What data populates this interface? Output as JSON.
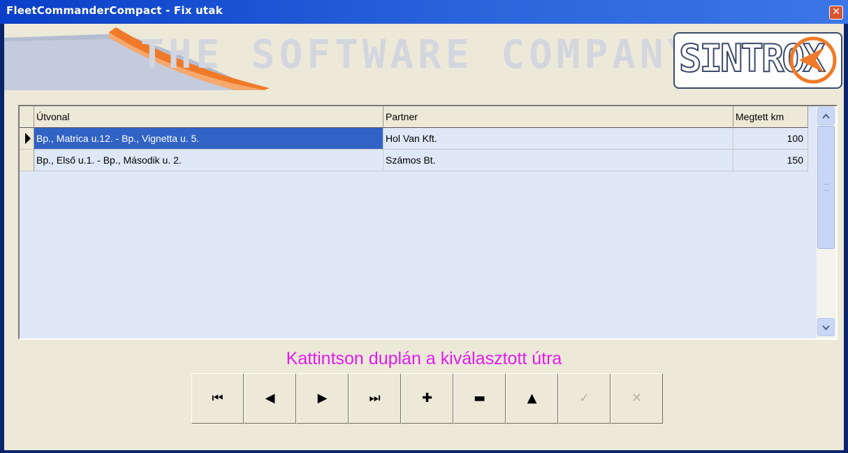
{
  "window": {
    "title": "FleetCommanderCompact - Fix utak",
    "close_glyph": "✕"
  },
  "banner": {
    "tagline": "THE SOFTWARE COMPANY...",
    "logo_text": "SINTROX"
  },
  "grid": {
    "columns": [
      "Útvonal",
      "Partner",
      "Megtett km"
    ],
    "rows": [
      {
        "route": "Bp., Matrica u.12. - Bp., Vignetta u. 5.",
        "partner": "Hol Van Kft.",
        "km": "100",
        "selected": true
      },
      {
        "route": "Bp., Első u.1. - Bp., Második u. 2.",
        "partner": "Számos Bt.",
        "km": "150",
        "selected": false
      }
    ]
  },
  "hint": "Kattintson duplán a kiválasztott útra",
  "navigator": {
    "buttons": [
      {
        "name": "first-record-button",
        "icon": "first-icon",
        "glyph": "⏮",
        "enabled": true
      },
      {
        "name": "prior-record-button",
        "icon": "prior-icon",
        "glyph": "◀",
        "enabled": true
      },
      {
        "name": "next-record-button",
        "icon": "next-icon",
        "glyph": "▶",
        "enabled": true
      },
      {
        "name": "last-record-button",
        "icon": "last-icon",
        "glyph": "⏭",
        "enabled": true
      },
      {
        "name": "insert-record-button",
        "icon": "plus-icon",
        "glyph": "✚",
        "enabled": true
      },
      {
        "name": "delete-record-button",
        "icon": "minus-icon",
        "glyph": "▬",
        "enabled": true
      },
      {
        "name": "edit-record-button",
        "icon": "up-arrow-icon",
        "glyph": "▲",
        "enabled": true
      },
      {
        "name": "post-record-button",
        "icon": "check-icon",
        "glyph": "✓",
        "enabled": false
      },
      {
        "name": "cancel-record-button",
        "icon": "cancel-icon",
        "glyph": "✕",
        "enabled": false
      }
    ]
  },
  "colors": {
    "titlebar": "#2a64dc",
    "selection": "#3163c5",
    "hint": "#e51aec",
    "logo_accent": "#f07a28"
  }
}
